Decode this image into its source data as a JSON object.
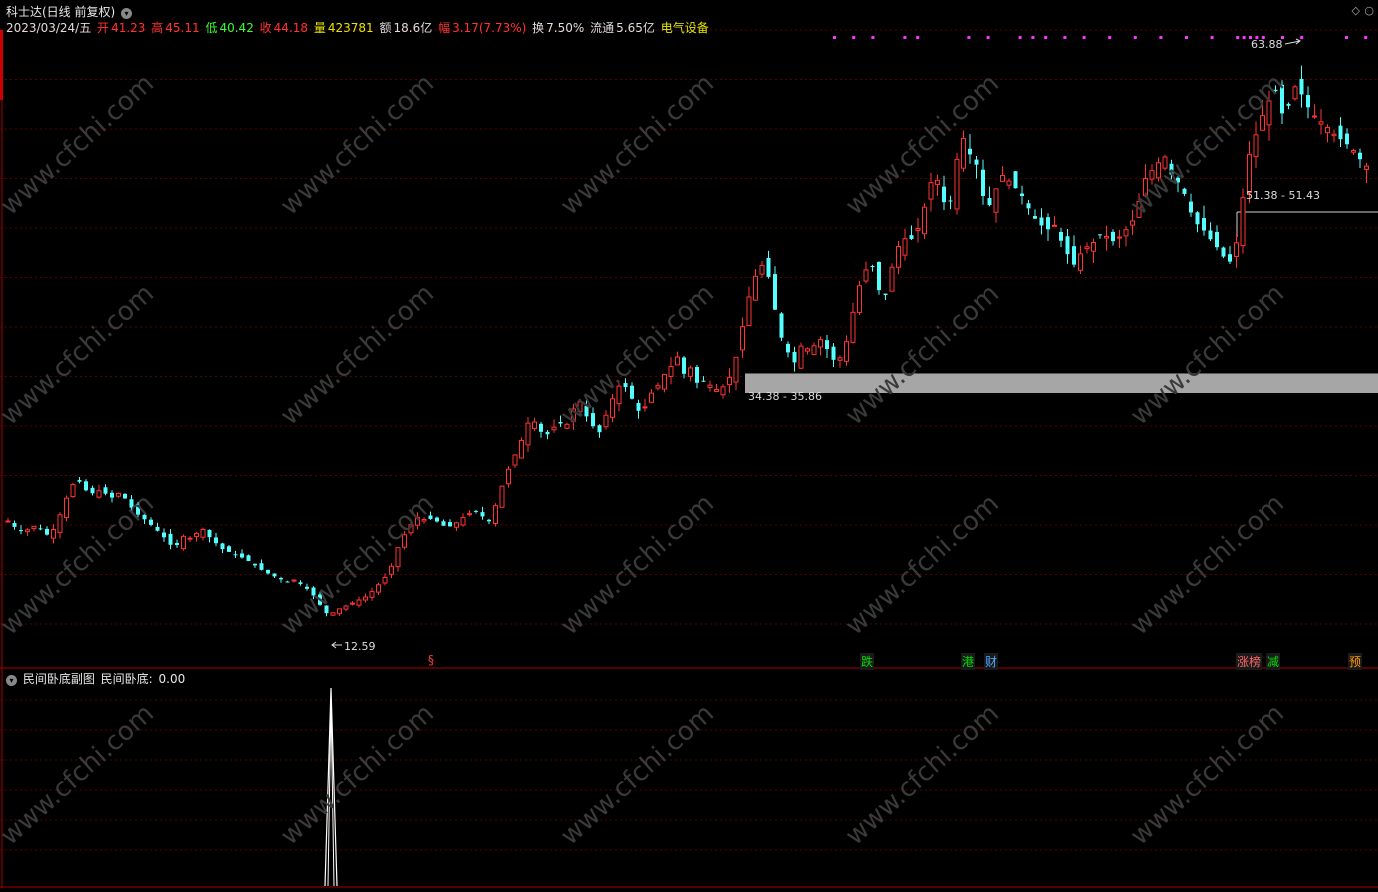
{
  "header": {
    "title": "科士达(日线 前复权)",
    "date": "2023/03/24/五",
    "open_label": "开",
    "open": "41.23",
    "high_label": "高",
    "high": "45.11",
    "low_label": "低",
    "low": "40.42",
    "close_label": "收",
    "close": "44.18",
    "vol_label": "量",
    "vol": "423781",
    "amt_label": "额",
    "amt": "18.6亿",
    "chg_label": "幅",
    "chg": "3.17(7.73%)",
    "turn_label": "换",
    "turn": "7.50%",
    "float_label": "流通",
    "float": "5.65亿",
    "industry": "电气设备"
  },
  "annotations": {
    "high_mark": "63.88",
    "low_mark": "12.59",
    "zone_low": "34.38 - 35.86",
    "zone_high": "51.38 - 51.43"
  },
  "news_tags": [
    {
      "text": "§",
      "color": "#ff3b3b",
      "bg": "transparent",
      "idx": 51
    },
    {
      "text": "跌",
      "color": "#00dd00",
      "bg": "#1a1a1a",
      "idx": 104
    },
    {
      "text": "港",
      "color": "#00dd00",
      "bg": "#1a1a1a",
      "idx": 116
    },
    {
      "text": "财",
      "color": "#4da6ff",
      "bg": "#1a1a1a",
      "idx": 119
    },
    {
      "text": "涨榜",
      "color": "#ff6666",
      "bg": "#1a1a1a",
      "idx": 150
    },
    {
      "text": "减",
      "color": "#00dd00",
      "bg": "#1a1a1a",
      "idx": 154
    },
    {
      "text": "预",
      "color": "#ff9900",
      "bg": "#1a1a1a",
      "idx": 165
    }
  ],
  "sub_panel": {
    "title": "民间卧底副图",
    "indicator_label": "民间卧底:",
    "indicator_value": "0.00"
  },
  "watermark": "www.cfchi.com",
  "colors": {
    "up": "#ff3333",
    "down": "#54ffff",
    "grid": "#5a0000",
    "magenta": "#ff33ff",
    "yellow": "#e6e600"
  },
  "chart_data": {
    "type": "candlestick",
    "ylim": [
      8,
      68
    ],
    "price_series": [
      22.0,
      21.4,
      21.0,
      21.2,
      21.6,
      21.0,
      20.5,
      21.8,
      23.5,
      25.2,
      26.0,
      25.0,
      24.6,
      24.9,
      24.6,
      24.2,
      24.7,
      24.0,
      23.0,
      22.4,
      22.0,
      21.3,
      20.8,
      19.9,
      19.4,
      20.6,
      20.3,
      20.8,
      21.2,
      20.4,
      19.8,
      19.2,
      19.0,
      18.7,
      18.4,
      18.0,
      17.5,
      17.1,
      16.8,
      16.5,
      16.2,
      16.4,
      16.0,
      15.5,
      14.8,
      13.8,
      13.0,
      13.4,
      13.8,
      14.0,
      14.4,
      14.6,
      15.1,
      15.8,
      16.5,
      17.6,
      19.5,
      20.8,
      21.8,
      22.5,
      22.0,
      22.3,
      21.7,
      21.4,
      21.6,
      22.2,
      22.6,
      23.0,
      22.5,
      21.9,
      23.5,
      25.5,
      27.2,
      28.6,
      30.1,
      32.0,
      31.0,
      30.0,
      30.6,
      31.5,
      30.8,
      32.5,
      33.5,
      32.0,
      31.0,
      30.4,
      32.4,
      34.0,
      35.2,
      34.5,
      33.0,
      32.0,
      34.0,
      34.5,
      35.8,
      36.5,
      37.8,
      36.0,
      36.6,
      35.0,
      35.4,
      34.8,
      34.4,
      35.0,
      36.2,
      39.0,
      42.5,
      44.8,
      46.5,
      45.8,
      42.4,
      39.5,
      38.0,
      37.0,
      39.0,
      38.2,
      38.9,
      39.5,
      37.5,
      37.2,
      38.0,
      41.0,
      44.0,
      45.8,
      46.5,
      44.0,
      43.5,
      46.5,
      48.5,
      49.0,
      48.8,
      50.5,
      53.0,
      55.5,
      53.0,
      51.2,
      55.8,
      58.7,
      57.0,
      56.0,
      52.8,
      52.0,
      54.0,
      55.2,
      54.0,
      53.5,
      52.5,
      51.0,
      50.5,
      49.5,
      50.5,
      48.9,
      47.5,
      46.4,
      47.5,
      48.2,
      48.6,
      49.5,
      48.9,
      48.5,
      49.5,
      50.0,
      51.4,
      54.4,
      55.2,
      56.0,
      56.8,
      55.0,
      54.2,
      53.0,
      51.0,
      50.0,
      49.5,
      48.4,
      47.8,
      46.5,
      47.0,
      51.4,
      56.5,
      58.5,
      60.5,
      62.0,
      63.0,
      60.5,
      61.8,
      63.9,
      62.0,
      61.0,
      60.2,
      59.8,
      59.0,
      58.5,
      58.0,
      57.4,
      56.5,
      55.8
    ],
    "x_count": 210,
    "marked_high": 63.88,
    "marked_low": 12.59,
    "zone_low": [
      34.38,
      35.86
    ],
    "zone_high": [
      51.38,
      51.43
    ],
    "sub_indicator": {
      "name": "民间卧底",
      "value": 0.0,
      "spike_index": 46
    }
  }
}
